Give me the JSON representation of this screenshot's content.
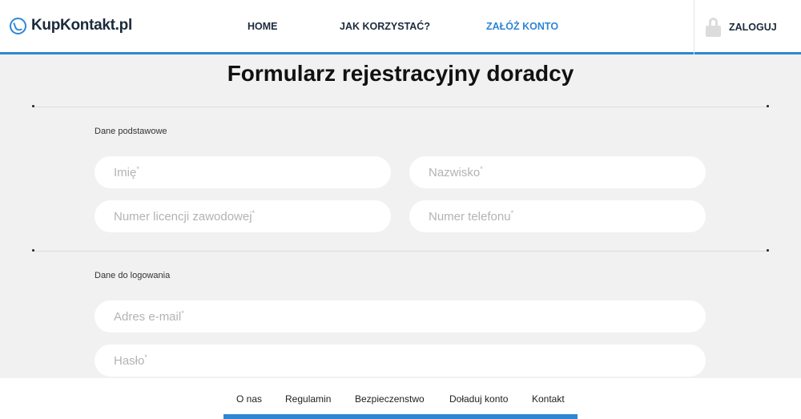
{
  "header": {
    "logo_text": "KupKontakt.pl",
    "nav": [
      {
        "label": "HOME"
      },
      {
        "label": "JAK KORZYSTAĆ?"
      },
      {
        "label": "ZAŁÓŻ KONTO"
      }
    ],
    "login_label": "ZALOGUJ"
  },
  "page_title": "Formularz rejestracyjny doradcy",
  "sections": [
    {
      "label": "Dane podstawowe",
      "fields": [
        {
          "placeholder": "Imię",
          "required": "*"
        },
        {
          "placeholder": "Nazwisko",
          "required": "*"
        },
        {
          "placeholder": "Numer licencji zawodowej",
          "required": "*"
        },
        {
          "placeholder": "Numer telefonu",
          "required": "*"
        }
      ]
    },
    {
      "label": "Dane do logowania",
      "fields": [
        {
          "placeholder": "Adres e-mail",
          "required": "*"
        },
        {
          "placeholder": "Hasło",
          "required": "*"
        }
      ]
    }
  ],
  "footer": {
    "links": [
      {
        "label": "O nas"
      },
      {
        "label": "Regulamin"
      },
      {
        "label": "Bezpieczenstwo"
      },
      {
        "label": "Doładuj konto"
      },
      {
        "label": "Kontakt"
      }
    ]
  },
  "colors": {
    "accent": "#2f86d3",
    "background": "#f1f1f1"
  },
  "icons": {
    "logo": "phone-circle-icon",
    "login": "padlock-icon"
  }
}
